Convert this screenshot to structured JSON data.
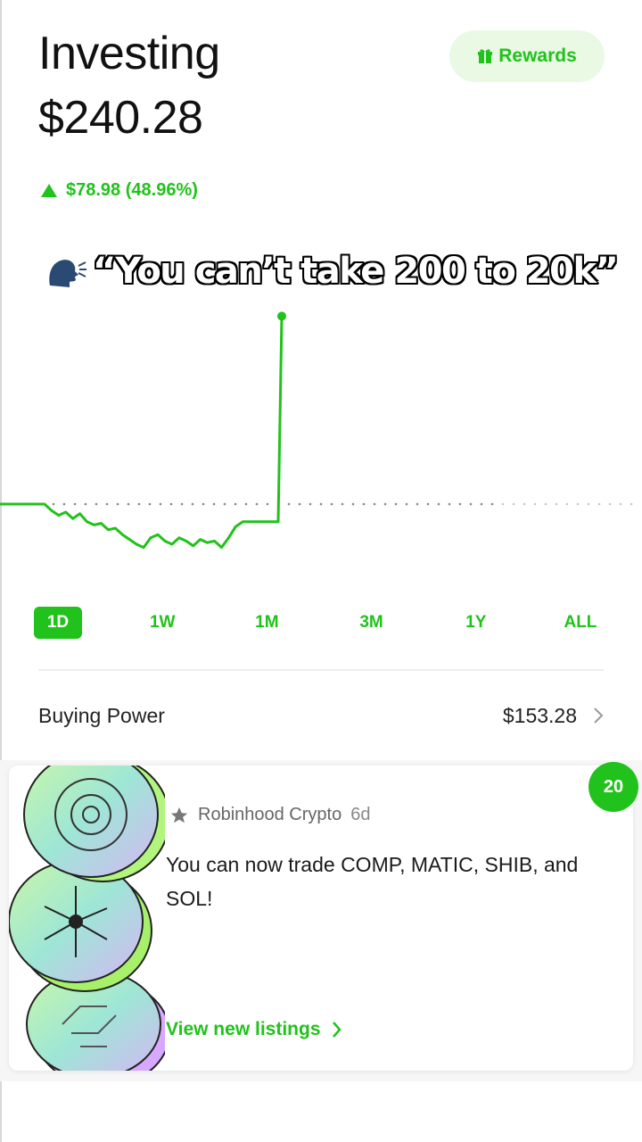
{
  "header": {
    "title": "Investing",
    "balance": "$240.28",
    "rewards_label": "Rewards",
    "change_text": "$78.98 (48.96%)"
  },
  "caption": {
    "text": "“You can’t take 200 to 20k”"
  },
  "chart_data": {
    "type": "line",
    "color": "#21c21b",
    "baseline": 0,
    "x": [
      0,
      1,
      2,
      3,
      4,
      5,
      6,
      7,
      8,
      9,
      10,
      11,
      12,
      13,
      14,
      15,
      16,
      17,
      18,
      19,
      20,
      21,
      22,
      23,
      24,
      25,
      26,
      27,
      28,
      29,
      30,
      31,
      32,
      33,
      34,
      35,
      36
    ],
    "values": [
      0,
      0,
      0,
      -4,
      -7,
      -5,
      -9,
      -6,
      -11,
      -13,
      -12,
      -16,
      -15,
      -19,
      -22,
      -25,
      -27,
      -21,
      -19,
      -23,
      -25,
      -21,
      -23,
      -26,
      -22,
      -24,
      -23,
      -27,
      -21,
      -14,
      -11,
      -11,
      -11,
      -11,
      -11,
      -11,
      117
    ],
    "grid": false
  },
  "ranges": [
    "1D",
    "1W",
    "1M",
    "3M",
    "1Y",
    "ALL"
  ],
  "active_range": "1D",
  "buying_power": {
    "label": "Buying Power",
    "value": "$153.28"
  },
  "news_card": {
    "badge_count": "20",
    "source": "Robinhood Crypto",
    "age": "6d",
    "headline": "You can now trade COMP, MATIC, SHIB, and SOL!",
    "link_label": "View new listings"
  },
  "colors": {
    "accent": "#21c21b",
    "rewards_bg": "#e9f9e4"
  },
  "icons": {
    "rewards": "gift-icon",
    "change": "up-triangle-icon",
    "caption": "speaking-head-icon",
    "row": "chevron-right-icon",
    "source": "star-icon"
  }
}
